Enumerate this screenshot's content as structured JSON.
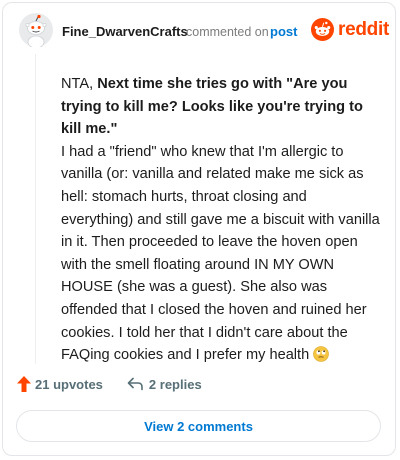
{
  "comment": {
    "username": "Fine_DwarvenCrafts",
    "meta_text": "commented on",
    "post_link": "post",
    "body_prefix": "NTA, ",
    "body_bold": "Next time she tries go with \"Are you trying to kill me? Looks like you're trying to kill me.\"",
    "body_text": "I had a \"friend\" who knew that I'm allergic to vanilla (or: vanilla and related make me sick as hell: stomach hurts, throat closing and everything) and still gave me a biscuit with vanilla in it. Then proceeded to leave the hoven open with the smell floating around IN MY OWN HOUSE (she was a guest). She also was offended that I closed the hoven and ruined her cookies. I told her that I didn't care about the FAQing cookies and I prefer my health",
    "emoji": "face-with-rolling-eyes"
  },
  "brand": {
    "wordmark": "reddit",
    "color": "#ff4500"
  },
  "actions": {
    "upvotes": "21 upvotes",
    "replies": "2 replies",
    "view_comments": "View 2 comments"
  },
  "colors": {
    "accent_blue": "#0079d3",
    "upvote_orange": "#ff4500",
    "muted_text": "#576f76"
  }
}
